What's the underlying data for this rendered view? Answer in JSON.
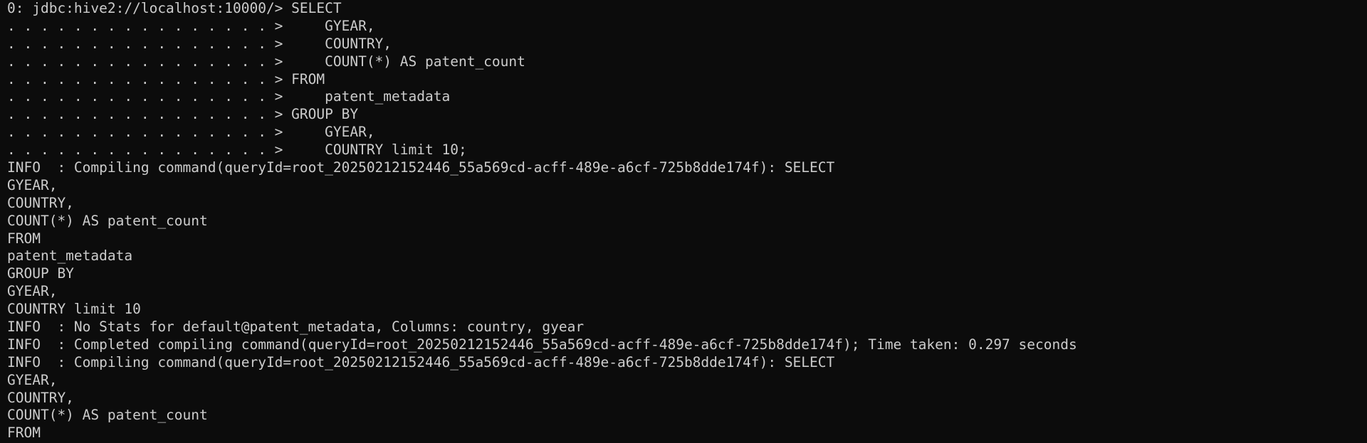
{
  "terminal": {
    "lines": [
      "0: jdbc:hive2://localhost:10000/> SELECT",
      ". . . . . . . . . . . . . . . . >     GYEAR,",
      ". . . . . . . . . . . . . . . . >     COUNTRY,",
      ". . . . . . . . . . . . . . . . >     COUNT(*) AS patent_count",
      ". . . . . . . . . . . . . . . . > FROM",
      ". . . . . . . . . . . . . . . . >     patent_metadata",
      ". . . . . . . . . . . . . . . . > GROUP BY",
      ". . . . . . . . . . . . . . . . >     GYEAR,",
      ". . . . . . . . . . . . . . . . >     COUNTRY limit 10;",
      "INFO  : Compiling command(queryId=root_20250212152446_55a569cd-acff-489e-a6cf-725b8dde174f): SELECT",
      "GYEAR,",
      "COUNTRY,",
      "COUNT(*) AS patent_count",
      "FROM",
      "patent_metadata",
      "GROUP BY",
      "GYEAR,",
      "COUNTRY limit 10",
      "INFO  : No Stats for default@patent_metadata, Columns: country, gyear",
      "INFO  : Completed compiling command(queryId=root_20250212152446_55a569cd-acff-489e-a6cf-725b8dde174f); Time taken: 0.297 seconds",
      "INFO  : Compiling command(queryId=root_20250212152446_55a569cd-acff-489e-a6cf-725b8dde174f): SELECT",
      "GYEAR,",
      "COUNTRY,",
      "COUNT(*) AS patent_count",
      "FROM"
    ]
  }
}
